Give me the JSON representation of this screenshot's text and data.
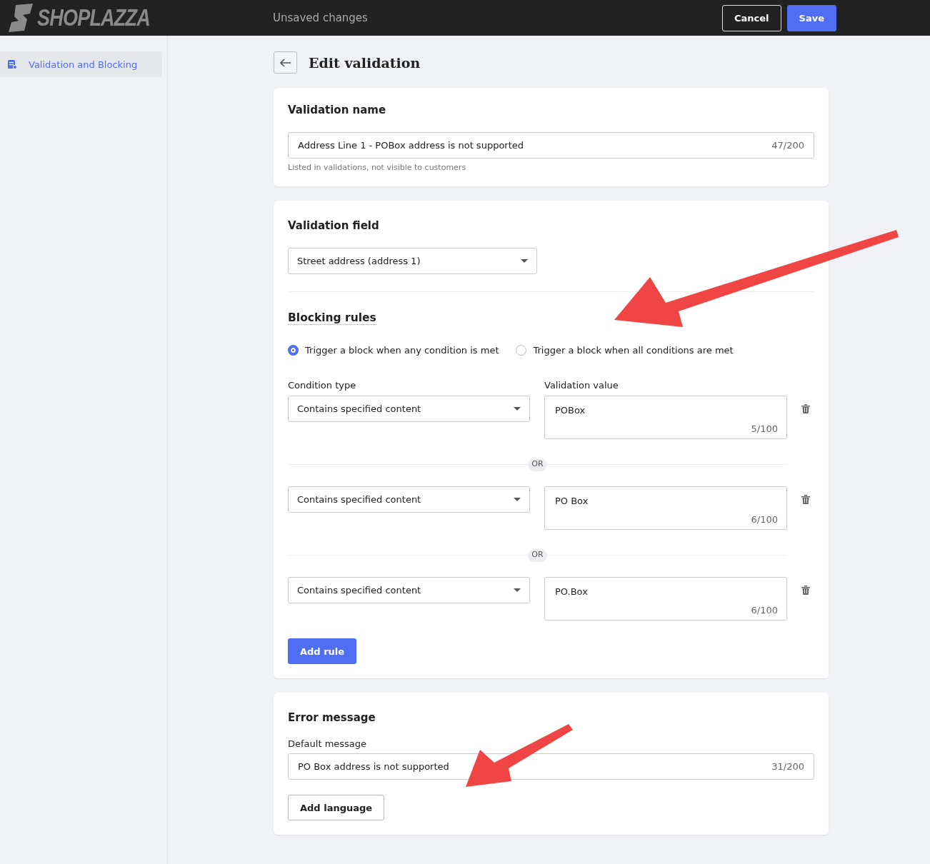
{
  "header": {
    "brand": "SHOPLAZZA",
    "status": "Unsaved changes",
    "buttons": [
      {
        "label": "Cancel",
        "kind": "secondary"
      },
      {
        "label": "Save",
        "kind": "primary"
      }
    ]
  },
  "sidebar": {
    "items": [
      {
        "label": "Validation and Blocking",
        "selected": true
      }
    ]
  },
  "page": {
    "title": "Edit validation"
  },
  "name_card": {
    "title": "Validation name",
    "value": "Address Line 1 - POBox address is not supported",
    "count": "47/200",
    "help": "Listed in validations, not visible to customers"
  },
  "field_card": {
    "title": "Validation field",
    "field": "Street address (address 1)",
    "rules_title": "Blocking rules",
    "options": [
      {
        "label": "Trigger a block when any condition is met",
        "selected": true
      },
      {
        "label": "Trigger a block when all conditions are met",
        "selected": false
      }
    ],
    "condition_label": "Condition type",
    "value_label": "Validation value",
    "separators": [
      "OR",
      "OR"
    ],
    "rules": [
      {
        "condition": "Contains specified content",
        "value": "POBox",
        "count": "5/100"
      },
      {
        "condition": "Contains specified content",
        "value": "PO Box",
        "count": "6/100"
      },
      {
        "condition": "Contains specified content",
        "value": "PO.Box",
        "count": "6/100"
      }
    ],
    "add_button": "Add rule"
  },
  "error_card": {
    "title": "Error message",
    "label": "Default message",
    "value": "PO Box address is not supported",
    "count": "31/200",
    "add_button": "Add language"
  }
}
